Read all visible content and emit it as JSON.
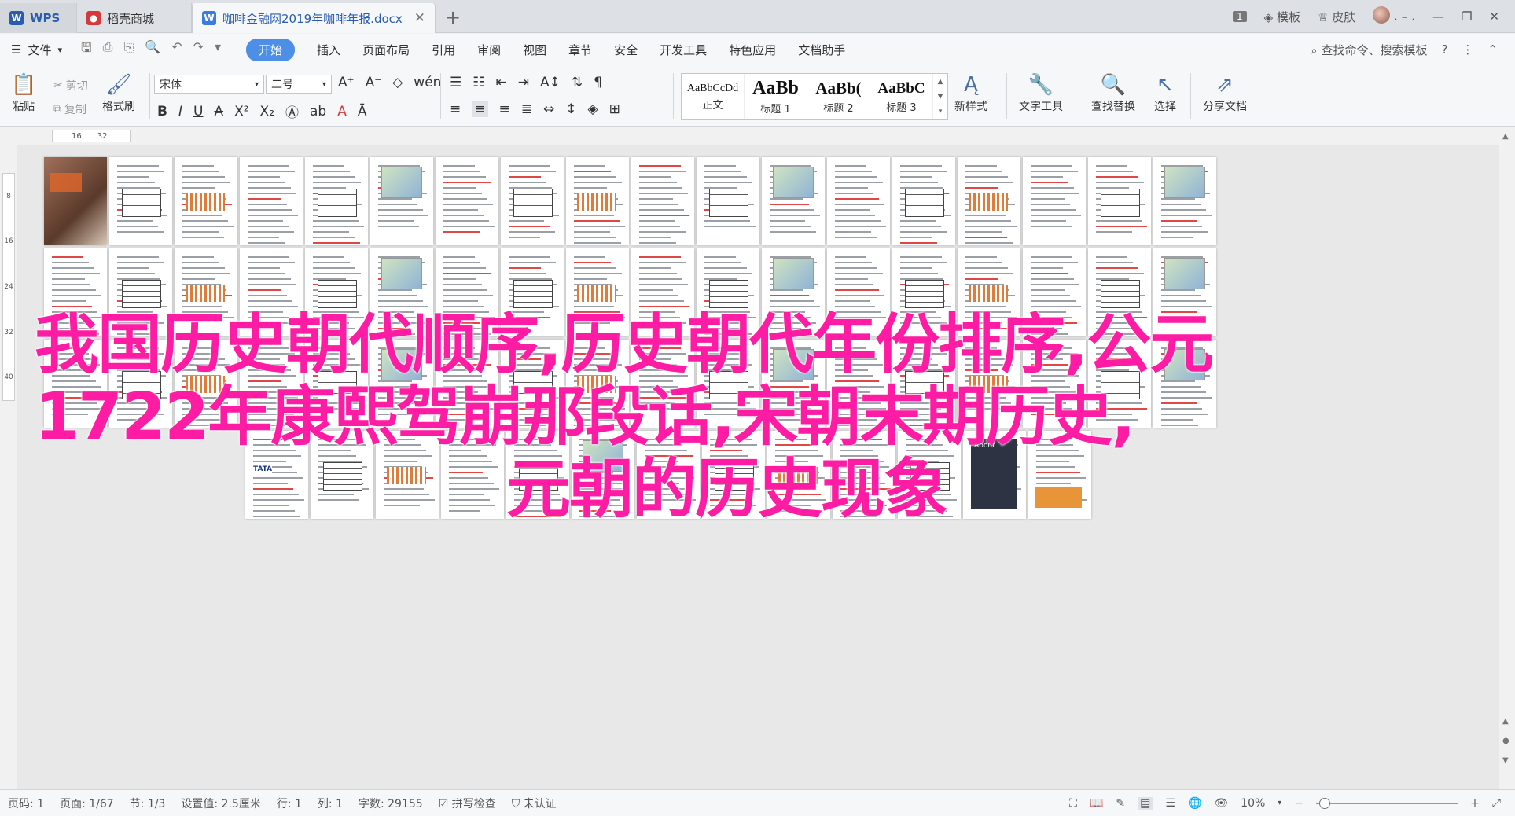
{
  "titlebar": {
    "tabs": [
      {
        "label": "WPS",
        "icon": "wps-logo-icon"
      },
      {
        "label": "稻壳商城",
        "icon": "docer-icon"
      },
      {
        "label": "咖啡金融网2019年咖啡年报.docx",
        "icon": "word-doc-icon"
      }
    ],
    "right": {
      "badge": "1",
      "template": "模板",
      "skin": "皮肤"
    }
  },
  "menubar": {
    "file": "文件",
    "items": [
      "开始",
      "插入",
      "页面布局",
      "引用",
      "审阅",
      "视图",
      "章节",
      "安全",
      "开发工具",
      "特色应用",
      "文档助手"
    ],
    "active": "开始",
    "search": "查找命令、搜索模板"
  },
  "ribbon": {
    "paste": "粘贴",
    "cut": "剪切",
    "copy": "复制",
    "format_painter": "格式刷",
    "font_name": "宋体",
    "font_size": "二号",
    "styles": [
      {
        "sample": "AaBbCcDd",
        "name": "正文"
      },
      {
        "sample": "AaBb",
        "name": "标题 1"
      },
      {
        "sample": "AaBb(",
        "name": "标题 2"
      },
      {
        "sample": "AaBbC",
        "name": "标题 3"
      }
    ],
    "new_style": "新样式",
    "text_tools": "文字工具",
    "find_replace": "查找替换",
    "select": "选择",
    "share": "分享文档"
  },
  "ruler": {
    "top": [
      "16",
      "32"
    ],
    "left": [
      "8",
      "16",
      "24",
      "32",
      "40"
    ]
  },
  "headline": {
    "line1": "我国历史朝代顺序,历史朝代年份排序,公元",
    "line2": "1722年康熙驾崩那段话,宋朝末期历史,",
    "line3": "元朝的历史现象"
  },
  "page_images": {
    "tata": "TATA",
    "about": "About"
  },
  "statusbar": {
    "pages": "页码: 1",
    "page_of": "页面: 1/67",
    "section": "节: 1/3",
    "setting": "设置值: 2.5厘米",
    "row": "行: 1",
    "col": "列: 1",
    "words": "字数: 29155",
    "spell": "拼写检查",
    "cert": "未认证",
    "zoom": "10%"
  },
  "colors": {
    "accent": "#4d8ee6",
    "headline": "#ff1ca4",
    "wps_red": "#d9373b"
  }
}
